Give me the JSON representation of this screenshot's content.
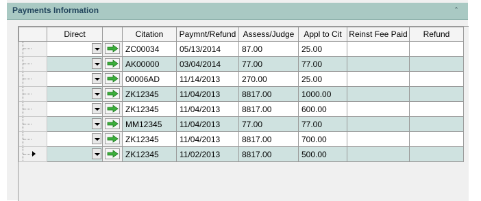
{
  "panel": {
    "title": "Payments Information",
    "collapse_glyph": "ˆ"
  },
  "grid": {
    "columns": [
      "Direct",
      "Citation",
      "Paymnt/Refund",
      "Assess/Judge",
      "Appl to Cit",
      "Reinst Fee Paid",
      "Refund"
    ],
    "rows": [
      {
        "citation": "ZC00034",
        "date": "05/13/2014",
        "assess": "87.00",
        "appl": "25.00",
        "reinst": "",
        "refund": ""
      },
      {
        "citation": "AK00000",
        "date": "03/04/2014",
        "assess": "77.00",
        "appl": "77.00",
        "reinst": "",
        "refund": ""
      },
      {
        "citation": "00006AD",
        "date": "11/14/2013",
        "assess": "270.00",
        "appl": "25.00",
        "reinst": "",
        "refund": ""
      },
      {
        "citation": "ZK12345",
        "date": "11/04/2013",
        "assess": "8817.00",
        "appl": "1000.00",
        "reinst": "",
        "refund": ""
      },
      {
        "citation": "ZK12345",
        "date": "11/04/2013",
        "assess": "8817.00",
        "appl": "600.00",
        "reinst": "",
        "refund": ""
      },
      {
        "citation": "MM12345",
        "date": "11/04/2013",
        "assess": "77.00",
        "appl": "77.00",
        "reinst": "",
        "refund": ""
      },
      {
        "citation": "ZK12345",
        "date": "11/04/2013",
        "assess": "8817.00",
        "appl": "700.00",
        "reinst": "",
        "refund": ""
      },
      {
        "citation": "ZK12345",
        "date": "11/02/2013",
        "assess": "8817.00",
        "appl": "500.00",
        "reinst": "",
        "refund": ""
      }
    ]
  },
  "icons": {
    "go": "green-arrow-icon",
    "dropdown": "chevron-down-icon",
    "collapse": "collapse-up-icon",
    "current_row": "row-pointer-icon"
  },
  "colors": {
    "header_bg": "#a9c9c3",
    "title": "#23465d",
    "alt_row": "#cfe2e0",
    "arrow": "#3cae3c"
  }
}
